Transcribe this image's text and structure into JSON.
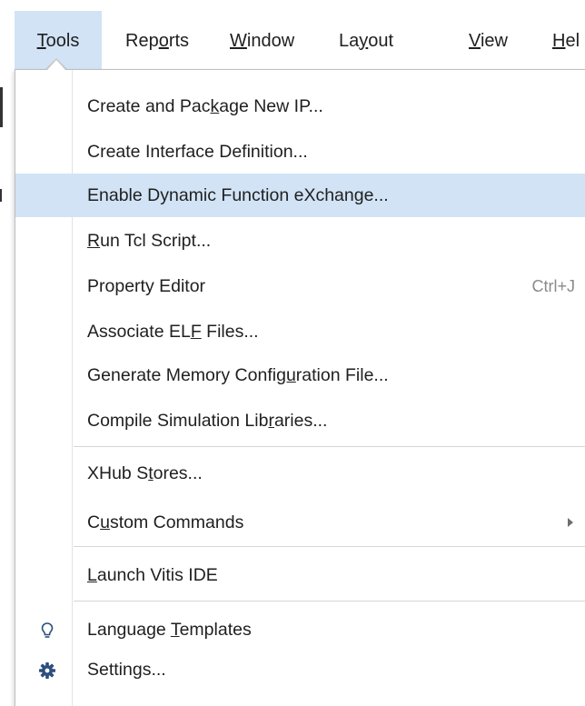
{
  "menubar": {
    "items": [
      {
        "pre": "",
        "ul": "T",
        "post": "ools"
      },
      {
        "pre": "Rep",
        "ul": "o",
        "post": "rts"
      },
      {
        "pre": "",
        "ul": "W",
        "post": "indow"
      },
      {
        "pre": "La",
        "ul": "y",
        "post": "out"
      },
      {
        "pre": "",
        "ul": "V",
        "post": "iew"
      },
      {
        "pre": "",
        "ul": "H",
        "post": "el"
      }
    ]
  },
  "dropdown": {
    "items": [
      {
        "pre": "Create and Pac",
        "ul": "k",
        "post": "age New IP..."
      },
      {
        "pre": "Create Interface Definition...",
        "ul": "",
        "post": ""
      },
      {
        "pre": "Enable Dynamic Function eXchange...",
        "ul": "",
        "post": ""
      },
      {
        "pre": "",
        "ul": "R",
        "post": "un Tcl Script..."
      },
      {
        "pre": "Property Editor",
        "ul": "",
        "post": "",
        "shortcut": "Ctrl+J"
      },
      {
        "pre": "Associate EL",
        "ul": "F",
        "post": " Files..."
      },
      {
        "pre": "Generate Memory Confi",
        "ul": "gu",
        "post": "ration File..."
      },
      {
        "pre": "Compile Simulation Lib",
        "ul": "r",
        "post": "aries..."
      },
      {
        "pre": "XHub S",
        "ul": "t",
        "post": "ores..."
      },
      {
        "pre": "C",
        "ul": "u",
        "post": "stom Commands"
      },
      {
        "pre": "",
        "ul": "L",
        "post": "aunch Vitis IDE"
      },
      {
        "pre": "Language ",
        "ul": "T",
        "post": "emplates",
        "icon": "lightbulb-icon"
      },
      {
        "pre": "Settings...",
        "ul": "",
        "post": "",
        "icon": "gear-icon"
      }
    ]
  },
  "colors": {
    "highlight": "#d2e3f6",
    "icon_blue": "#2d4f7c"
  }
}
